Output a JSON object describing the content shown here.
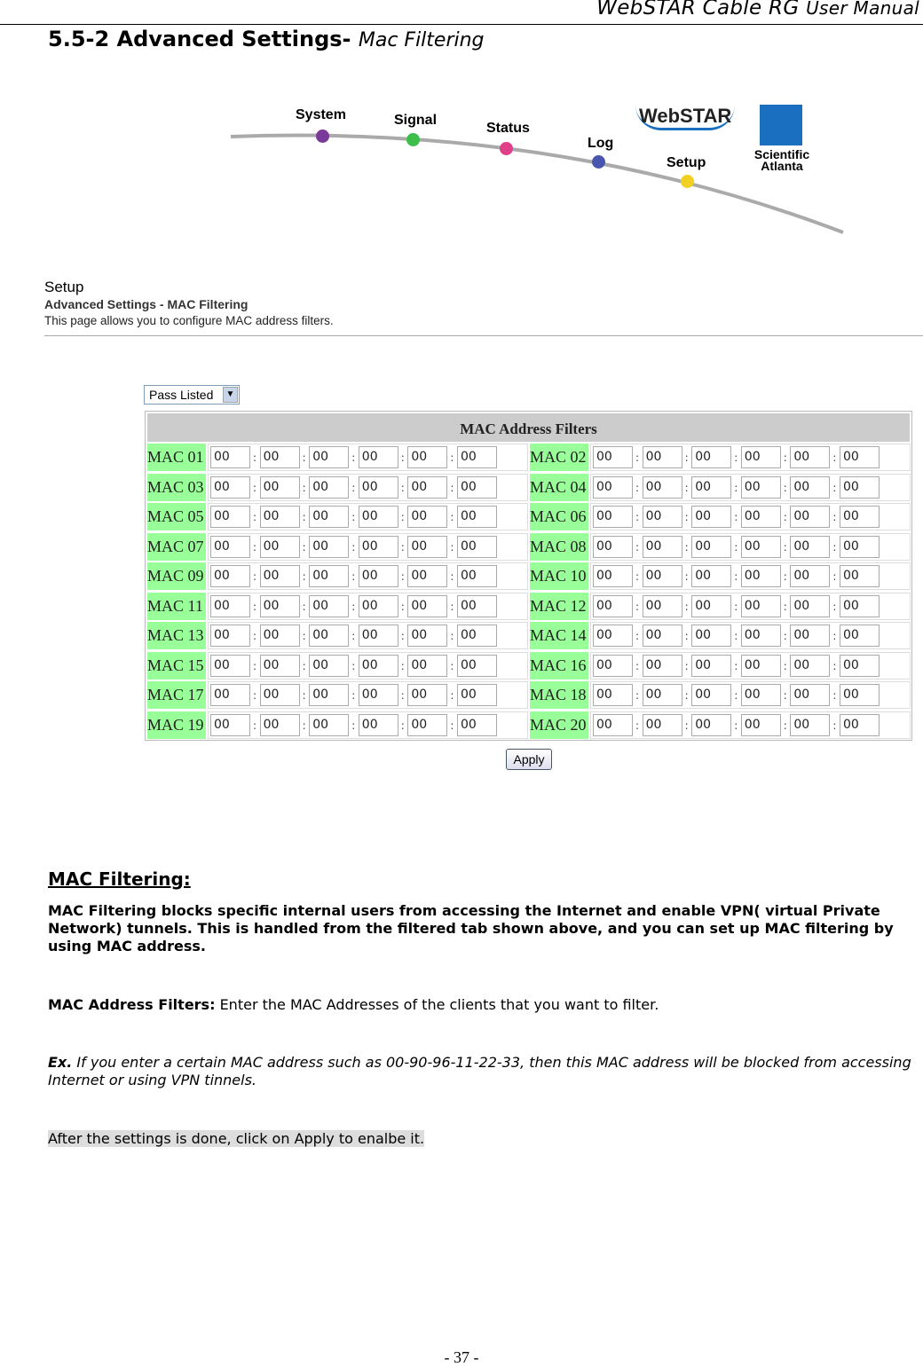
{
  "header": {
    "title_main": "WebSTAR Cable RG",
    "title_suffix": "User Manual"
  },
  "section": {
    "number_title": "5.5-2 Advanced Settings-",
    "subtitle": "Mac Filtering"
  },
  "nav": {
    "items": [
      {
        "label": "System",
        "color": "#7a3a9a"
      },
      {
        "label": "Signal",
        "color": "#3cbf4a"
      },
      {
        "label": "Status",
        "color": "#e0408a"
      },
      {
        "label": "Log",
        "color": "#4a55b0"
      },
      {
        "label": "Setup",
        "color": "#f0d020"
      }
    ],
    "logo_text": "WebSTAR",
    "brand_logo_text": [
      "Scientific",
      "Atlanta"
    ]
  },
  "setup": {
    "title": "Setup",
    "subtitle": "Advanced Settings - MAC Filtering",
    "description": "This page allows you to configure MAC address filters."
  },
  "filter_mode": {
    "selected": "Pass Listed"
  },
  "table": {
    "header": "MAC Address Filters",
    "label_color": "#99ff99",
    "rows": [
      [
        {
          "label": "MAC 01",
          "octets": [
            "00",
            "00",
            "00",
            "00",
            "00",
            "00"
          ]
        },
        {
          "label": "MAC 02",
          "octets": [
            "00",
            "00",
            "00",
            "00",
            "00",
            "00"
          ]
        }
      ],
      [
        {
          "label": "MAC 03",
          "octets": [
            "00",
            "00",
            "00",
            "00",
            "00",
            "00"
          ]
        },
        {
          "label": "MAC 04",
          "octets": [
            "00",
            "00",
            "00",
            "00",
            "00",
            "00"
          ]
        }
      ],
      [
        {
          "label": "MAC 05",
          "octets": [
            "00",
            "00",
            "00",
            "00",
            "00",
            "00"
          ]
        },
        {
          "label": "MAC 06",
          "octets": [
            "00",
            "00",
            "00",
            "00",
            "00",
            "00"
          ]
        }
      ],
      [
        {
          "label": "MAC 07",
          "octets": [
            "00",
            "00",
            "00",
            "00",
            "00",
            "00"
          ]
        },
        {
          "label": "MAC 08",
          "octets": [
            "00",
            "00",
            "00",
            "00",
            "00",
            "00"
          ]
        }
      ],
      [
        {
          "label": "MAC 09",
          "octets": [
            "00",
            "00",
            "00",
            "00",
            "00",
            "00"
          ]
        },
        {
          "label": "MAC 10",
          "octets": [
            "00",
            "00",
            "00",
            "00",
            "00",
            "00"
          ]
        }
      ],
      [
        {
          "label": "MAC 11",
          "octets": [
            "00",
            "00",
            "00",
            "00",
            "00",
            "00"
          ]
        },
        {
          "label": "MAC 12",
          "octets": [
            "00",
            "00",
            "00",
            "00",
            "00",
            "00"
          ]
        }
      ],
      [
        {
          "label": "MAC 13",
          "octets": [
            "00",
            "00",
            "00",
            "00",
            "00",
            "00"
          ]
        },
        {
          "label": "MAC 14",
          "octets": [
            "00",
            "00",
            "00",
            "00",
            "00",
            "00"
          ]
        }
      ],
      [
        {
          "label": "MAC 15",
          "octets": [
            "00",
            "00",
            "00",
            "00",
            "00",
            "00"
          ]
        },
        {
          "label": "MAC 16",
          "octets": [
            "00",
            "00",
            "00",
            "00",
            "00",
            "00"
          ]
        }
      ],
      [
        {
          "label": "MAC 17",
          "octets": [
            "00",
            "00",
            "00",
            "00",
            "00",
            "00"
          ]
        },
        {
          "label": "MAC 18",
          "octets": [
            "00",
            "00",
            "00",
            "00",
            "00",
            "00"
          ]
        }
      ],
      [
        {
          "label": "MAC 19",
          "octets": [
            "00",
            "00",
            "00",
            "00",
            "00",
            "00"
          ]
        },
        {
          "label": "MAC 20",
          "octets": [
            "00",
            "00",
            "00",
            "00",
            "00",
            "00"
          ]
        }
      ]
    ]
  },
  "apply_label": "Apply",
  "explanation": {
    "heading": "MAC Filtering:",
    "intro": "MAC Filtering blocks specific internal users from accessing the Internet and enable VPN( virtual Private Network) tunnels. This is handled from the filtered tab shown above, and you can set up MAC filtering by using MAC address.",
    "filters_label": "MAC Address Filters:",
    "filters_text": " Enter the MAC Addresses of the clients that you want to filter.",
    "ex_label": "Ex.",
    "ex_text": " If you enter a certain MAC address such as 00-90-96-11-22-33, then this MAC address will be blocked from accessing Internet or using VPN tinnels.",
    "done_text": "After the settings is done, click on Apply to enalbe it."
  },
  "page_number": "- 37 -"
}
